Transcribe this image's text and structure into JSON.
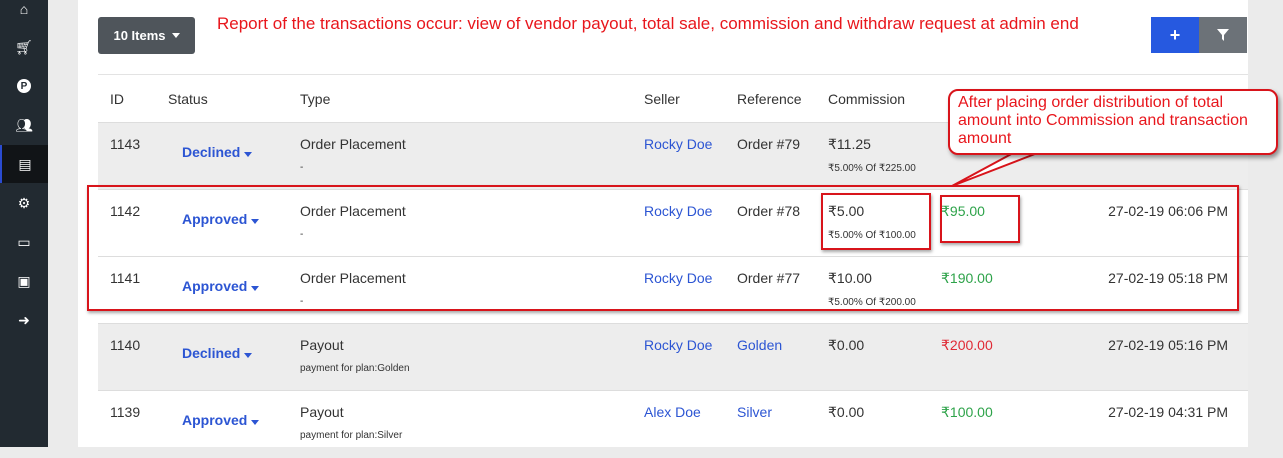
{
  "sidebar": {
    "icons": [
      "home-icon",
      "cart-icon",
      "parking-icon",
      "users-icon",
      "report-icon",
      "settings-icon",
      "credit-card-icon",
      "id-card-icon",
      "logout-icon"
    ],
    "active": 4
  },
  "toolbar": {
    "items_label": "10 Items",
    "add_label": "+",
    "filter_label": "filter"
  },
  "annotation": {
    "report": "Report of the transactions occur: view of vendor payout, total sale, commission and withdraw request at admin end",
    "callout": "After placing order distribution of total amount into Commission and transaction amount"
  },
  "table": {
    "headers": [
      "ID",
      "Status",
      "Type",
      "Seller",
      "Reference",
      "Commission"
    ],
    "rows": [
      {
        "id": "1143",
        "status": "Declined",
        "type": "Order Placement",
        "type_sub": "-",
        "seller": "Rocky Doe",
        "reference": "Order #79",
        "commission": "₹11.25",
        "commission_sub": "₹5.00% Of ₹225.00",
        "amount": "",
        "date": ""
      },
      {
        "id": "1142",
        "status": "Approved",
        "type": "Order Placement",
        "type_sub": "-",
        "seller": "Rocky Doe",
        "reference": "Order #78",
        "commission": "₹5.00",
        "commission_sub": "₹5.00% Of ₹100.00",
        "amount": "₹95.00",
        "date": "27-02-19 06:06 PM"
      },
      {
        "id": "1141",
        "status": "Approved",
        "type": "Order Placement",
        "type_sub": "-",
        "seller": "Rocky Doe",
        "reference": "Order #77",
        "commission": "₹10.00",
        "commission_sub": "₹5.00% Of ₹200.00",
        "amount": "₹190.00",
        "date": "27-02-19 05:18 PM"
      },
      {
        "id": "1140",
        "status": "Declined",
        "type": "Payout",
        "type_sub": "payment for plan:Golden",
        "seller": "Rocky Doe",
        "reference": "Golden",
        "commission": "₹0.00",
        "commission_sub": "",
        "amount": "₹200.00",
        "date": "27-02-19 05:16 PM"
      },
      {
        "id": "1139",
        "status": "Approved",
        "type": "Payout",
        "type_sub": "payment for plan:Silver",
        "seller": "Alex Doe",
        "reference": "Silver",
        "commission": "₹0.00",
        "commission_sub": "",
        "amount": "₹100.00",
        "date": "27-02-19 04:31 PM"
      }
    ]
  }
}
